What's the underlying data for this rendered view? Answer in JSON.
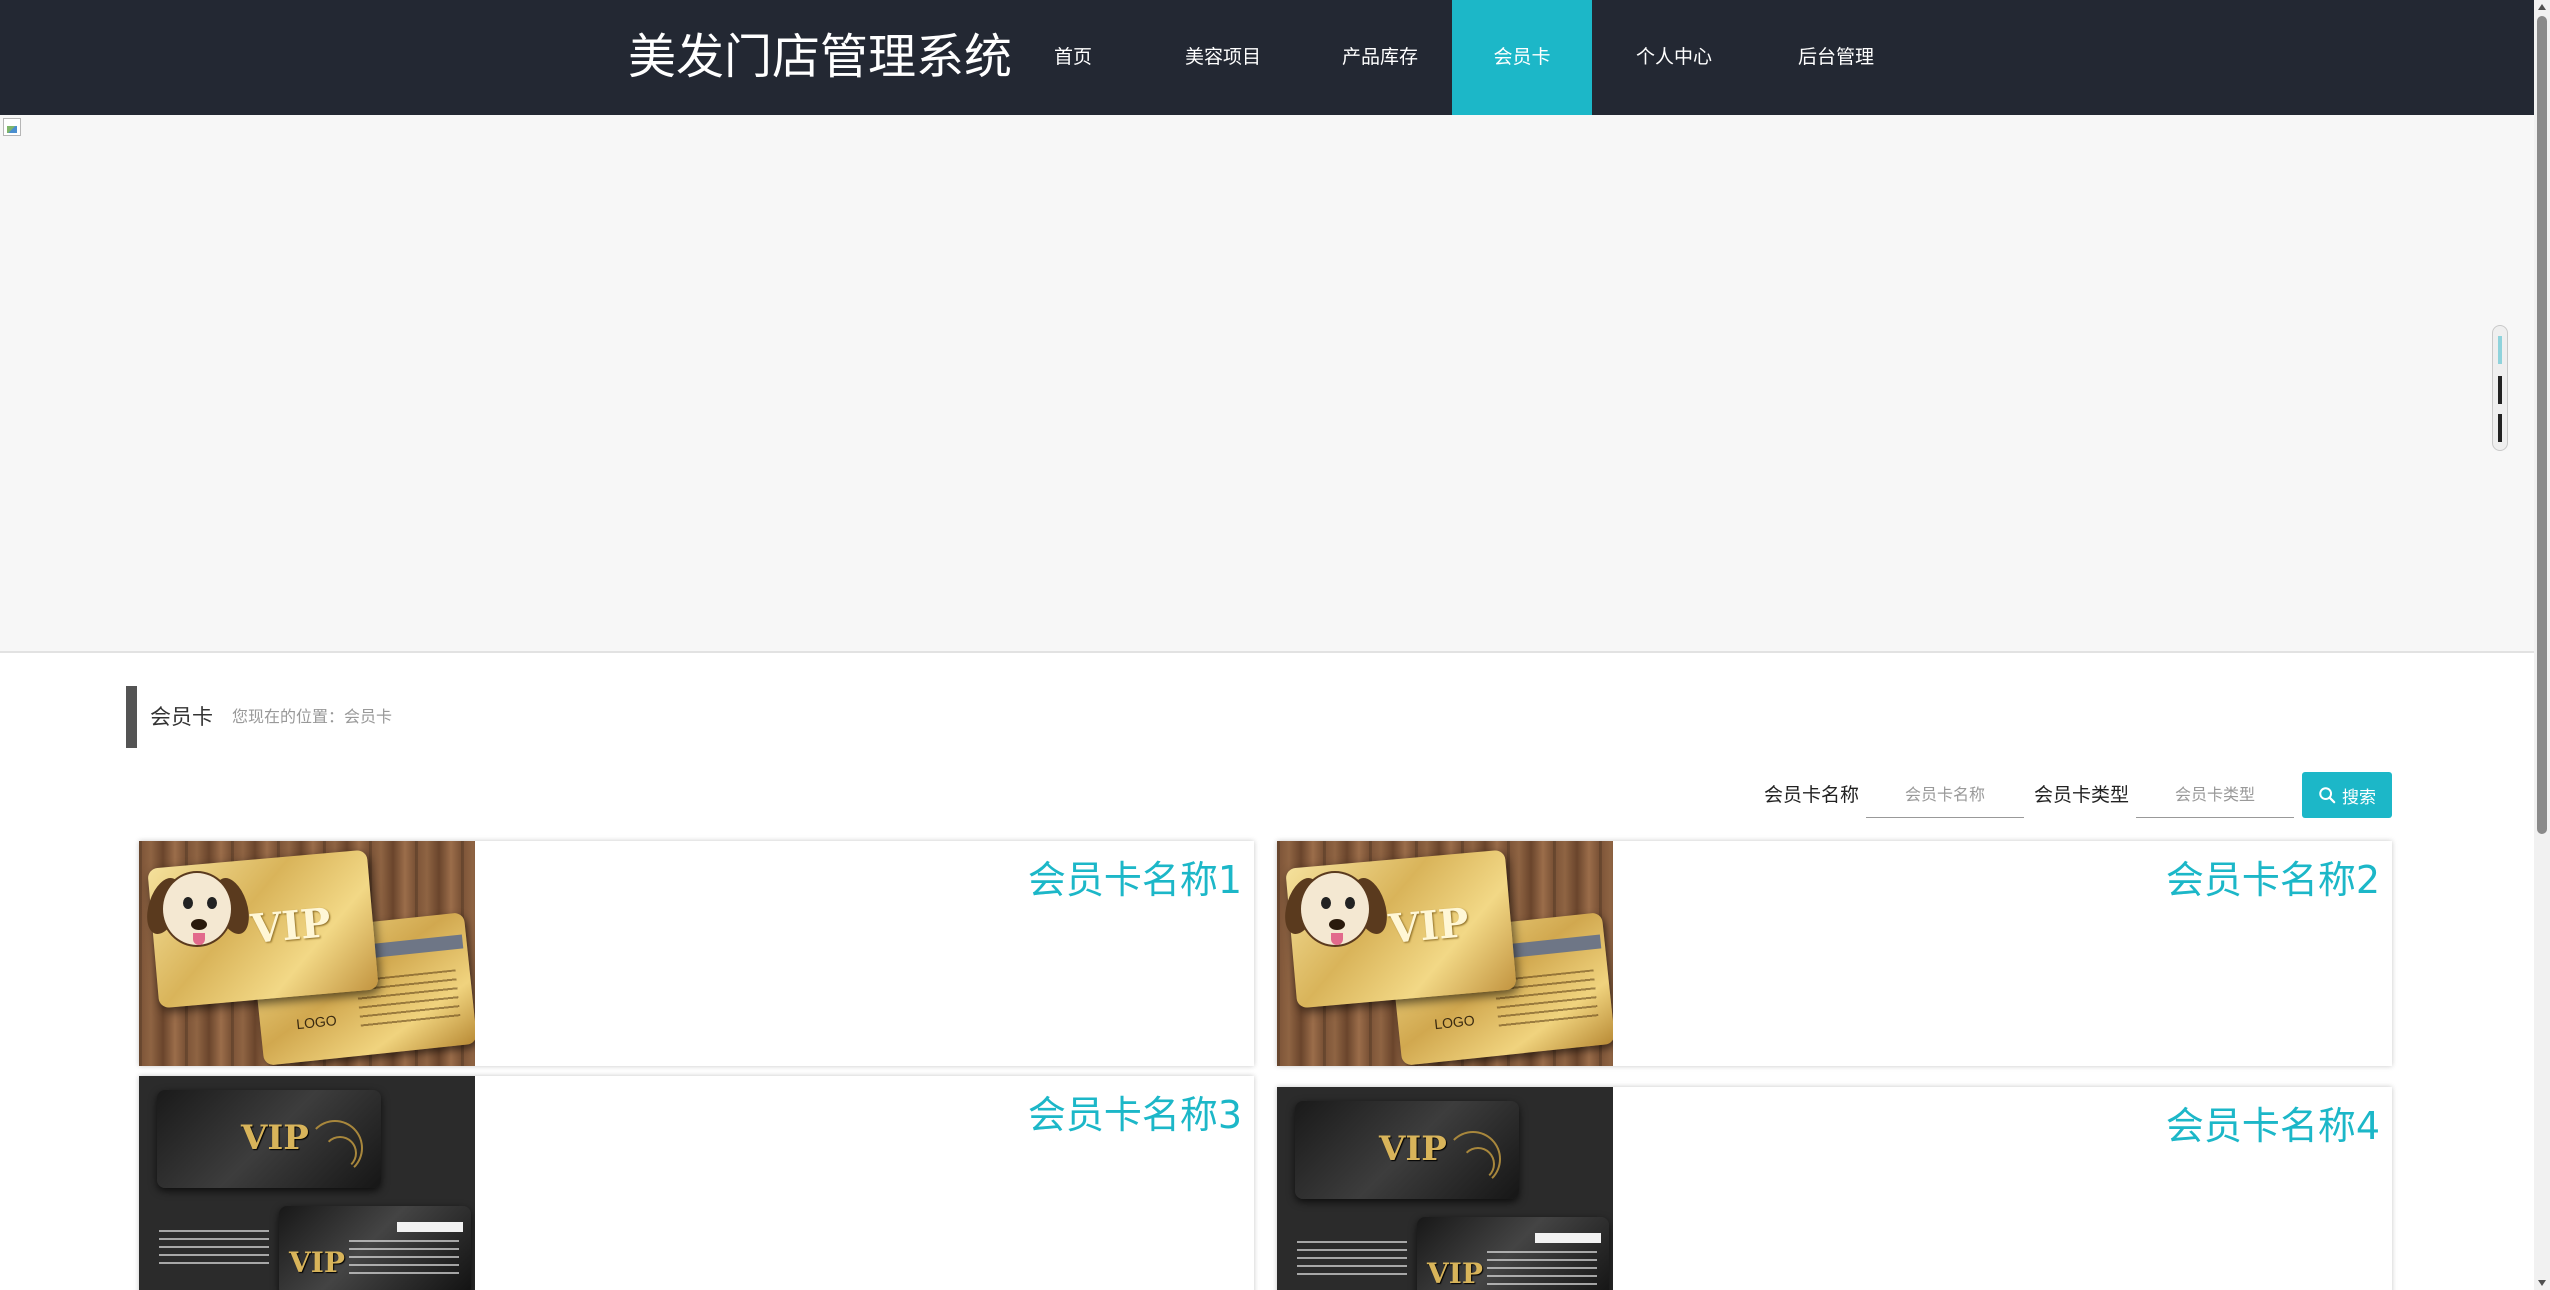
{
  "header": {
    "brand": "美发门店管理系统",
    "nav": [
      {
        "label": "首页"
      },
      {
        "label": "美容项目"
      },
      {
        "label": "产品库存"
      },
      {
        "label": "会员卡"
      },
      {
        "label": "个人中心"
      },
      {
        "label": "后台管理"
      }
    ],
    "active_nav": "会员卡"
  },
  "section": {
    "title": "会员卡",
    "breadcrumb": "您现在的位置：会员卡"
  },
  "search": {
    "name_label": "会员卡名称",
    "name_placeholder": "会员卡名称",
    "type_label": "会员卡类型",
    "type_placeholder": "会员卡类型",
    "button_label": "搜索"
  },
  "cards": [
    {
      "title": "会员卡名称1",
      "image": "gold-vip-card"
    },
    {
      "title": "会员卡名称2",
      "image": "gold-vip-card"
    },
    {
      "title": "会员卡名称3",
      "image": "black-vip-card"
    },
    {
      "title": "会员卡名称4",
      "image": "black-vip-card"
    }
  ],
  "colors": {
    "navbar": "#232833",
    "accent": "#1cb7c8",
    "banner": "#f7f7f7",
    "section_bar": "#545454"
  },
  "icons": [
    "broken-image-icon",
    "search-icon"
  ]
}
